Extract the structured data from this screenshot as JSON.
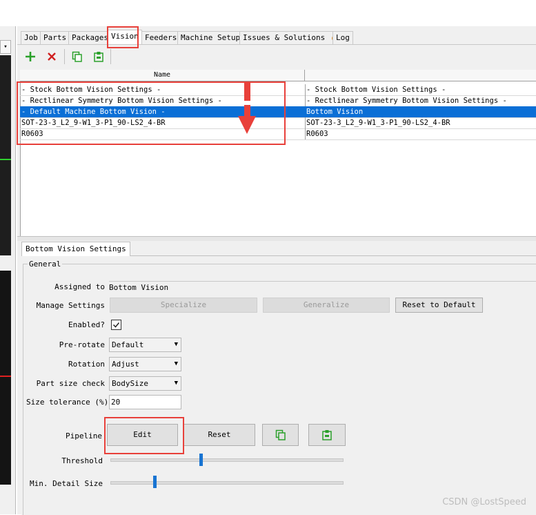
{
  "tabs": [
    {
      "label": "Job",
      "active": false
    },
    {
      "label": "Parts",
      "active": false
    },
    {
      "label": "Packages",
      "active": false
    },
    {
      "label": "Vision",
      "active": true
    },
    {
      "label": "Feeders",
      "active": false
    },
    {
      "label": "Machine Setup",
      "active": false
    },
    {
      "label": "Issues & Solutions",
      "active": false
    },
    {
      "label": "Log",
      "active": false
    }
  ],
  "toolbar": {
    "add_icon": "plus-icon",
    "delete_icon": "x-icon",
    "copy_icon": "copy-icon",
    "paste_icon": "paste-icon"
  },
  "table": {
    "headers": [
      "Name",
      ""
    ],
    "rows": [
      {
        "name": "- Stock Bottom Vision Settings -",
        "value": "- Stock Bottom Vision Settings -",
        "selected": false
      },
      {
        "name": "- Rectlinear Symmetry Bottom Vision Settings -",
        "value": "- Rectlinear Symmetry Bottom Vision Settings -",
        "selected": false
      },
      {
        "name": "- Default Machine Bottom Vision -",
        "value": "Bottom Vision",
        "selected": true
      },
      {
        "name": "SOT-23-3_L2_9-W1_3-P1_90-LS2_4-BR",
        "value": "SOT-23-3_L2_9-W1_3-P1_90-LS2_4-BR",
        "selected": false
      },
      {
        "name": "R0603",
        "value": "R0603",
        "selected": false
      }
    ]
  },
  "settings": {
    "tab_label": "Bottom Vision Settings",
    "group_label": "General",
    "assigned_to_label": "Assigned to",
    "assigned_to_value": "Bottom Vision",
    "manage_label": "Manage Settings",
    "specialize_label": "Specialize",
    "generalize_label": "Generalize",
    "reset_default_label": "Reset to Default",
    "enabled_label": "Enabled?",
    "enabled_checked": true,
    "prerotate_label": "Pre-rotate",
    "prerotate_value": "Default",
    "rotation_label": "Rotation",
    "rotation_value": "Adjust",
    "partsize_label": "Part size check",
    "partsize_value": "BodySize",
    "tolerance_label": "Size tolerance (%)",
    "tolerance_value": "20",
    "pipeline_label": "Pipeline",
    "edit_label": "Edit",
    "reset_label": "Reset",
    "threshold_label": "Threshold",
    "threshold_level": 0.39,
    "mindetail_label": "Min. Detail Size",
    "mindetail_level": 0.19
  },
  "watermark": "CSDN @LostSpeed",
  "colors": {
    "selection": "#0a6fd6",
    "highlight": "#e8403a",
    "issue_dot": "#d98c2b",
    "add_green": "#2aa02a",
    "delete_red": "#d02020"
  }
}
